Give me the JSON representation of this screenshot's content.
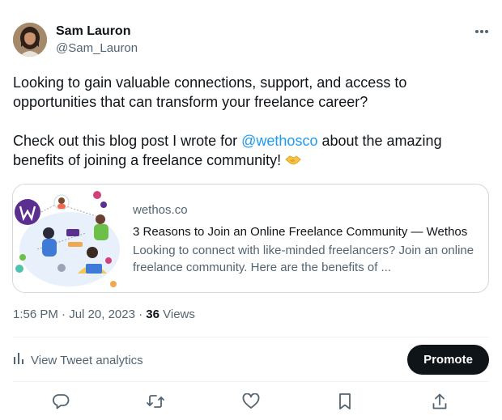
{
  "author": {
    "name": "Sam Lauron",
    "handle": "@Sam_Lauron",
    "avatar_icon": "profile-photo"
  },
  "more_icon": "more-horizontal-icon",
  "tweet": {
    "para1": "Looking to gain valuable connections, support, and access to opportunities that can transform your freelance career?",
    "para2_before": "Check out this blog post I wrote for ",
    "mention": "@wethosco",
    "para2_after": " about the amazing benefits of joining a freelance community! ",
    "emoji": "🫱"
  },
  "card": {
    "domain": "wethos.co",
    "title": "3 Reasons to Join an Online Freelance Community — Wethos",
    "description": "Looking to connect with like-minded freelancers? Join an online freelance community. Here are the benefits of ..."
  },
  "meta": {
    "time": "1:56 PM",
    "sep1": " · ",
    "date": "Jul 20, 2023",
    "sep2": " · ",
    "views_count": "36",
    "views_label": " Views"
  },
  "analytics": {
    "label": "View Tweet analytics",
    "icon": "analytics-bars-icon"
  },
  "promote_label": "Promote",
  "actions": [
    "reply-icon",
    "retweet-icon",
    "like-icon",
    "bookmark-icon",
    "share-icon"
  ],
  "colors": {
    "text": "#0f1419",
    "secondary": "#536471",
    "link": "#1d9bf0",
    "border": "#cfd9de",
    "button": "#0f1419"
  }
}
